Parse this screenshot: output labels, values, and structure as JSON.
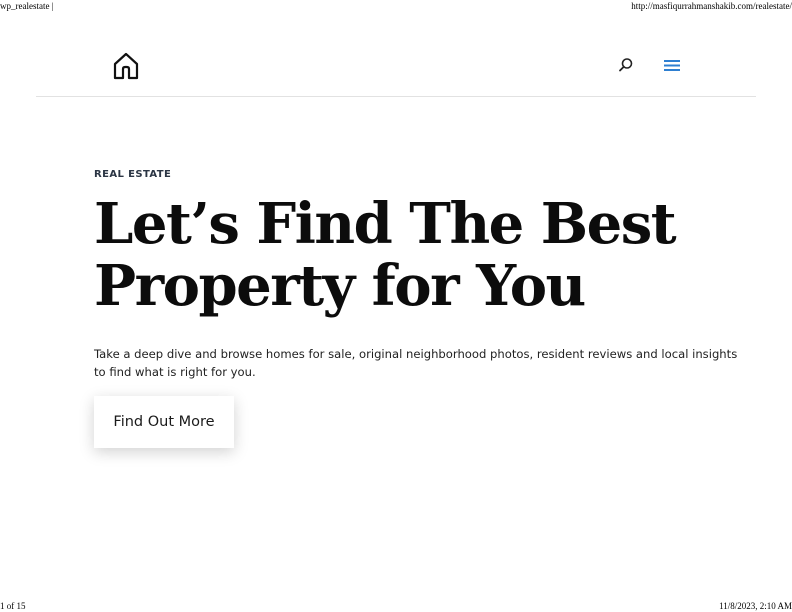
{
  "print": {
    "header_left": "wp_realestate |",
    "header_right": "http://masfiqurrahmanshakib.com/realestate/",
    "footer_left": "1 of 15",
    "footer_right": "11/8/2023, 2:10 AM"
  },
  "header": {
    "logo_icon": "house-icon",
    "search_icon": "search-icon",
    "menu_icon": "hamburger-menu-icon",
    "accent_color": "#2e7fd1"
  },
  "hero": {
    "eyebrow": "REAL ESTATE",
    "title_line1": "Let’s Find The Best",
    "title_line2": "Property for You",
    "description": "Take a deep dive and browse homes for sale, original neighborhood photos, resident reviews and local insights to find what is right for you.",
    "cta_label": "Find Out More"
  }
}
